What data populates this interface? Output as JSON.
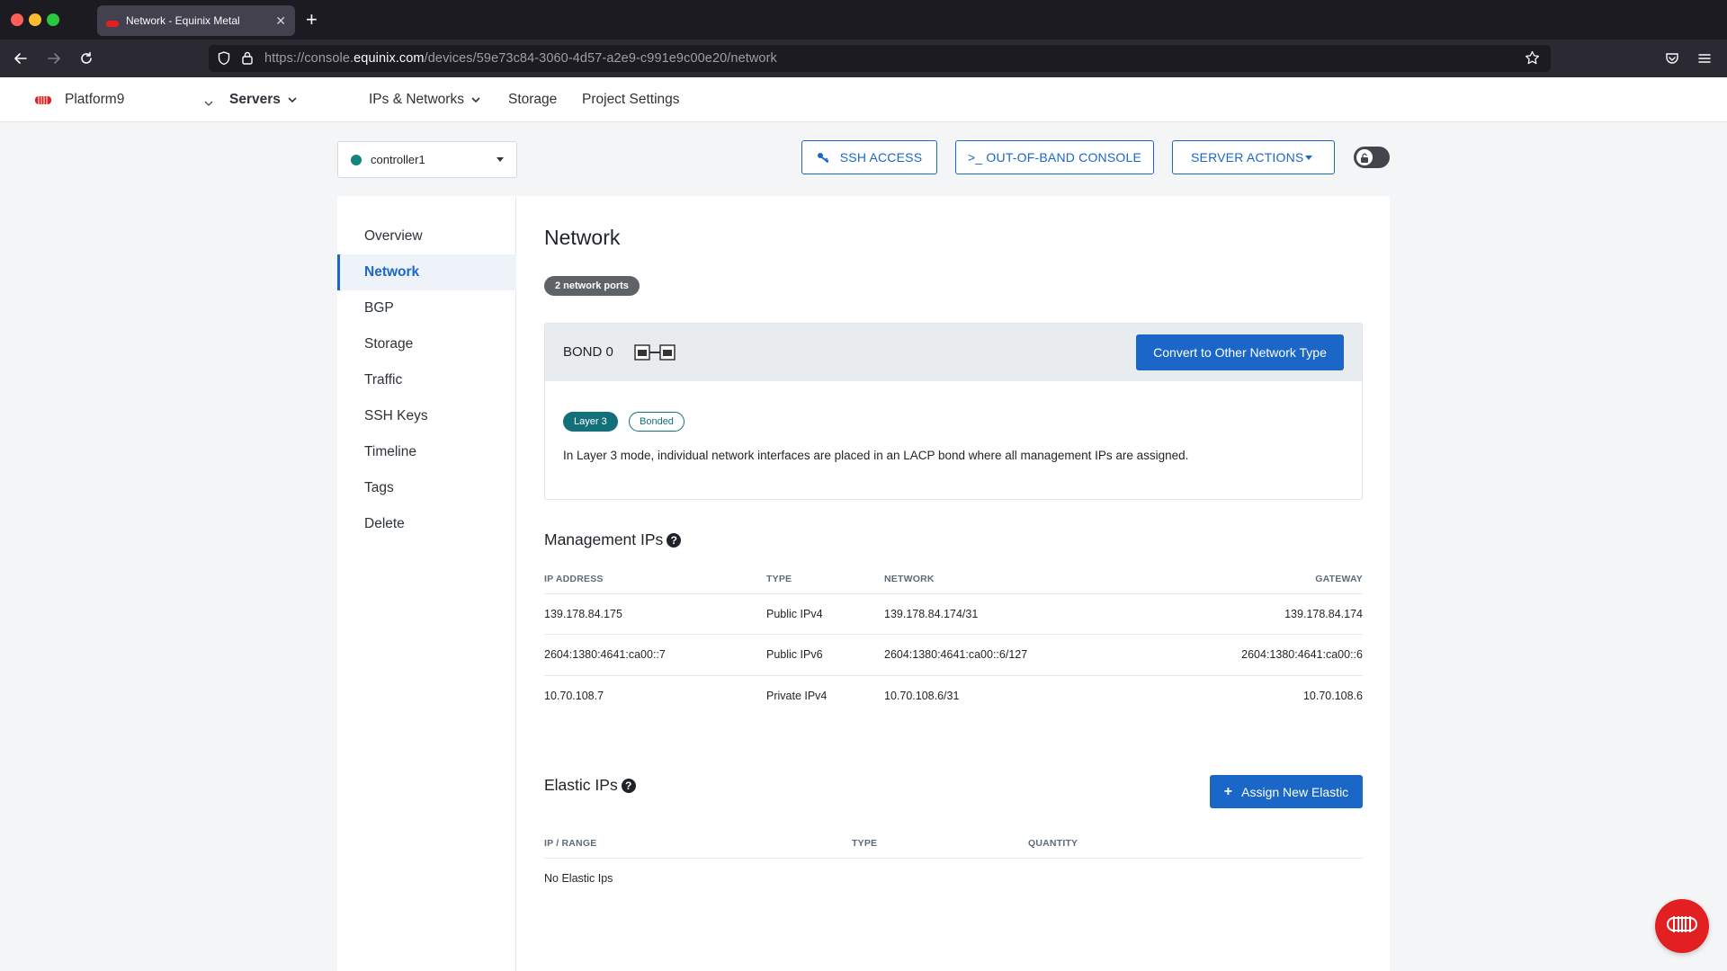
{
  "browser": {
    "tab_title": "Network - Equinix Metal",
    "url_prefix": "https://console.",
    "url_domain": "equinix.com",
    "url_path": "/devices/59e73c84-3060-4d57-a2e9-c991e9c00e20/network"
  },
  "app_nav": {
    "project": "Platform9",
    "servers": "Servers",
    "ips_networks": "IPs & Networks",
    "storage": "Storage",
    "project_settings": "Project Settings"
  },
  "toolbar": {
    "server_name": "controller1",
    "ssh_access": "SSH ACCESS",
    "oob_console": ">_ OUT-OF-BAND CONSOLE",
    "server_actions": "SERVER ACTIONS"
  },
  "sidebar": {
    "items": [
      {
        "label": "Overview",
        "active": false
      },
      {
        "label": "Network",
        "active": true
      },
      {
        "label": "BGP",
        "active": false
      },
      {
        "label": "Storage",
        "active": false
      },
      {
        "label": "Traffic",
        "active": false
      },
      {
        "label": "SSH Keys",
        "active": false
      },
      {
        "label": "Timeline",
        "active": false
      },
      {
        "label": "Tags",
        "active": false
      },
      {
        "label": "Delete",
        "active": false
      }
    ]
  },
  "network": {
    "title": "Network",
    "ports_badge": "2 network ports",
    "bond": {
      "title": "BOND 0",
      "convert_button": "Convert to Other Network Type",
      "tag_layer": "Layer 3",
      "tag_bonded": "Bonded",
      "description": "In Layer 3 mode, individual network interfaces are placed in an LACP bond where all management IPs are assigned."
    }
  },
  "management_ips": {
    "title": "Management IPs",
    "headers": {
      "ip": "IP ADDRESS",
      "type": "TYPE",
      "network": "NETWORK",
      "gateway": "GATEWAY"
    },
    "rows": [
      {
        "ip": "139.178.84.175",
        "type": "Public IPv4",
        "network": "139.178.84.174/31",
        "gateway": "139.178.84.174"
      },
      {
        "ip": "2604:1380:4641:ca00::7",
        "type": "Public IPv6",
        "network": "2604:1380:4641:ca00::6/127",
        "gateway": "2604:1380:4641:ca00::6"
      },
      {
        "ip": "10.70.108.7",
        "type": "Private IPv4",
        "network": "10.70.108.6/31",
        "gateway": "10.70.108.6"
      }
    ]
  },
  "elastic_ips": {
    "title": "Elastic IPs",
    "assign_button": "Assign New Elastic",
    "headers": {
      "range": "IP / RANGE",
      "type": "TYPE",
      "quantity": "QUANTITY"
    },
    "empty_text": "No Elastic Ips"
  },
  "colors": {
    "primary": "#1a67c7",
    "teal": "#13707b",
    "brand_red": "#e32021",
    "status_green": "#13857b"
  }
}
